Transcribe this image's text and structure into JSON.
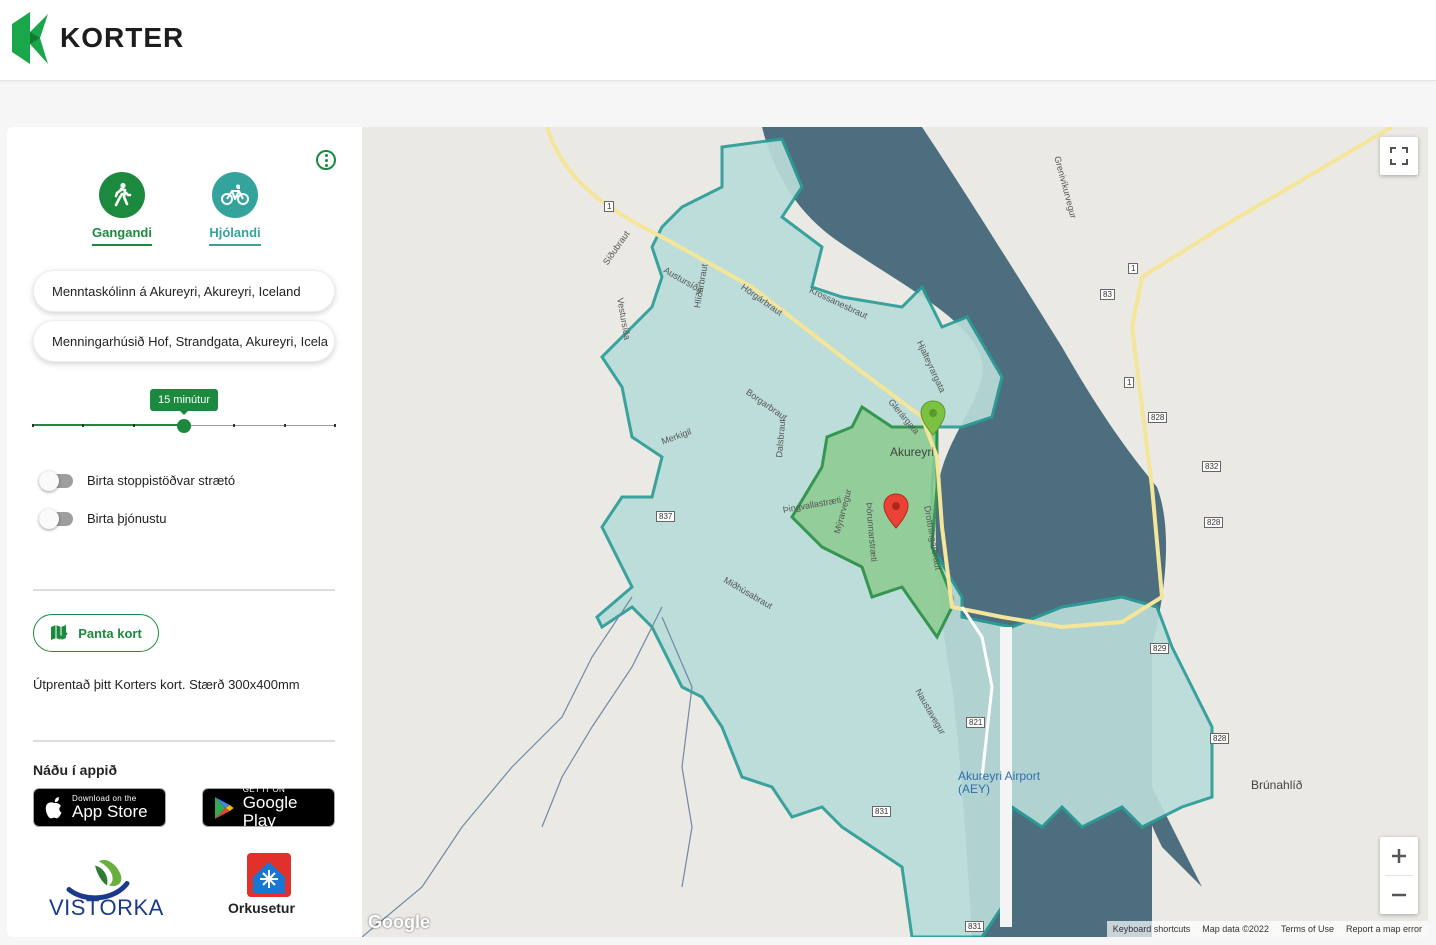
{
  "header": {
    "brand": "KORTER"
  },
  "panel": {
    "modes": [
      {
        "label": "Gangandi",
        "icon": "walking-icon",
        "selected": true
      },
      {
        "label": "Hjólandi",
        "icon": "bicycle-icon",
        "selected": false
      }
    ],
    "origin_value": "Menntaskólinn á Akureyri, Akureyri, Iceland",
    "destination_value": "Menningarhúsið Hof, Strandgata, Akureyri, Icela",
    "slider": {
      "label": "15 minútur",
      "fraction": 0.5,
      "ticks": 7
    },
    "toggles": [
      {
        "label": "Birta stoppistöðvar strætó",
        "on": false
      },
      {
        "label": "Birta þjónustu",
        "on": false
      }
    ],
    "order_button": "Panta kort",
    "print_text": "Útprentað þitt Korters kort. Stærð 300x400mm",
    "app_section_title": "Náðu í appið",
    "app_store": {
      "small": "Download on the",
      "big": "App Store"
    },
    "google_play": {
      "small": "GET IT ON",
      "big": "Google Play"
    },
    "partners": [
      "VISTORKA",
      "Orkusetur"
    ]
  },
  "map": {
    "places": {
      "city": "Akureyri",
      "airport": "Akureyri Airport (AEY)",
      "village": "Brúnahlíð"
    },
    "streets": [
      "Síðubraut",
      "Vestursíða",
      "Austursíða",
      "Hlíðarbraut",
      "Hörgárbraut",
      "Krossanesbraut",
      "Hjalteyrargata",
      "Borgarbraut",
      "Glerárgata",
      "Merkigil",
      "Dalsbraut",
      "Þingvallastræti",
      "Mýrarvegur",
      "Þórunnarstræti",
      "Drottningarbraut",
      "Miðhúsabraut",
      "Naustavegur",
      "Grenivíkurvegur"
    ],
    "route_shields": [
      "1",
      "83",
      "1",
      "1",
      "828",
      "832",
      "828",
      "837",
      "829",
      "821",
      "828",
      "831",
      "831"
    ],
    "attribution": [
      "Keyboard shortcuts",
      "Map data ©2022",
      "Terms of Use",
      "Report a map error"
    ],
    "google_watermark": "Google",
    "colors": {
      "water": "#4c6e7e",
      "walk_zone": "#b9dcd9",
      "walk_zone_border": "#2a9d96",
      "inner_zone": "#8ccb8f",
      "inner_border": "#1e8a3a",
      "brand_green": "#1c8a3e"
    }
  }
}
